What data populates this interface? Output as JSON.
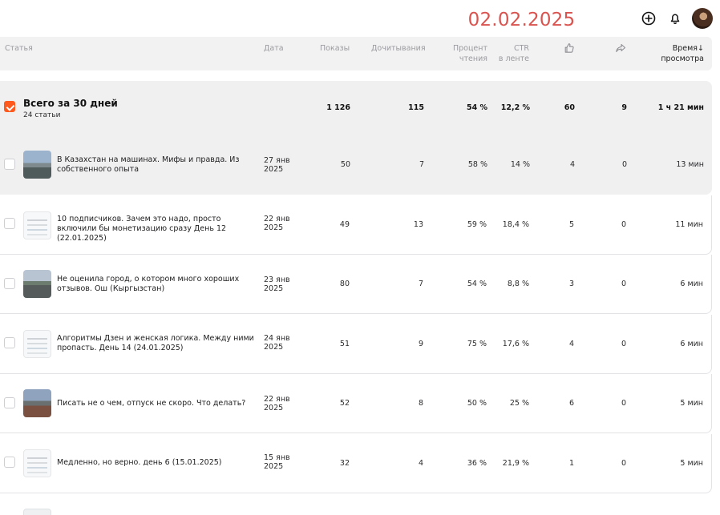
{
  "overlay_date": "02.02.2025",
  "top_icons": [
    "plus-circle-icon",
    "bell-icon",
    "avatar"
  ],
  "header": {
    "article": "Статья",
    "date": "Дата",
    "views": "Показы",
    "reads": "Дочитывания",
    "read_pct_1": "Процент",
    "read_pct_2": "чтения",
    "ctr_1": "CTR",
    "ctr_2": "в ленте",
    "time_1": "Время",
    "time_2": "просмотра",
    "sort_arrow": "↓"
  },
  "total": {
    "title": "Всего за 30 дней",
    "subtitle": "24 статьи",
    "views": "1 126",
    "reads": "115",
    "read_pct": "54 %",
    "ctr": "12,2 %",
    "likes": "60",
    "shares": "9",
    "time": "1 ч 21 мин"
  },
  "rows": [
    {
      "title": "В Казахстан на машинах. Мифы и правда. Из собственного опыта",
      "date_1": "27 янв",
      "date_2": "2025",
      "views": "50",
      "reads": "7",
      "read_pct": "58 %",
      "ctr": "14 %",
      "likes": "4",
      "shares": "0",
      "time": "13 мин"
    },
    {
      "title": "10 подписчиков. Зачем это надо, просто включили бы монетизацию сразу День 12 (22.01.2025)",
      "date_1": "22 янв",
      "date_2": "2025",
      "views": "49",
      "reads": "13",
      "read_pct": "59 %",
      "ctr": "18,4 %",
      "likes": "5",
      "shares": "0",
      "time": "11 мин"
    },
    {
      "title": "Не оценила город, о котором много хороших отзывов. Ош (Кыргызстан)",
      "date_1": "23 янв",
      "date_2": "2025",
      "views": "80",
      "reads": "7",
      "read_pct": "54 %",
      "ctr": "8,8 %",
      "likes": "3",
      "shares": "0",
      "time": "6 мин"
    },
    {
      "title": "Алгоритмы Дзен и женская логика. Между ними пропасть. День 14 (24.01.2025)",
      "date_1": "24 янв",
      "date_2": "2025",
      "views": "51",
      "reads": "9",
      "read_pct": "75 %",
      "ctr": "17,6 %",
      "likes": "4",
      "shares": "0",
      "time": "6 мин"
    },
    {
      "title": "Писать не о чем, отпуск не скоро. Что делать?",
      "date_1": "22 янв",
      "date_2": "2025",
      "views": "52",
      "reads": "8",
      "read_pct": "50 %",
      "ctr": "25 %",
      "likes": "6",
      "shares": "0",
      "time": "5 мин"
    },
    {
      "title": "Медленно, но верно. день 6 (15.01.2025)",
      "date_1": "15 янв",
      "date_2": "2025",
      "views": "32",
      "reads": "4",
      "read_pct": "36 %",
      "ctr": "21,9 %",
      "likes": "1",
      "shares": "0",
      "time": "5 мин"
    }
  ]
}
